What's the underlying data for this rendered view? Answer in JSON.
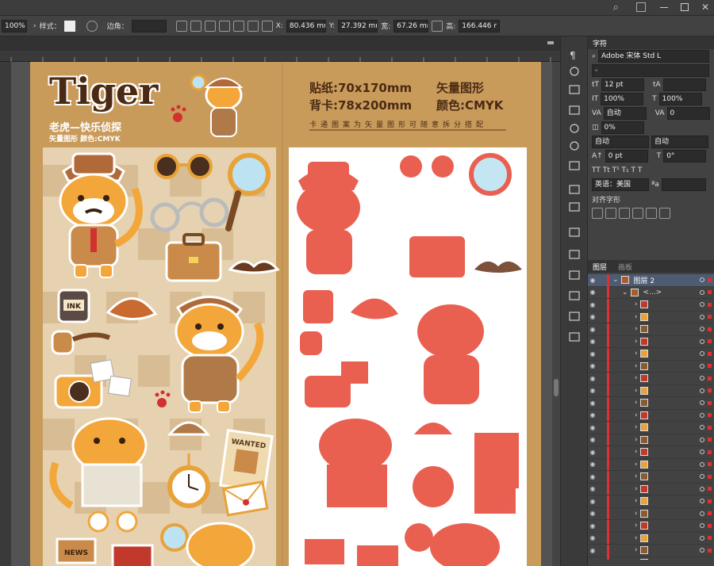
{
  "toolbar": {
    "zoom": "100%",
    "style_label": "样式：",
    "corner_label": "边角：",
    "x_label": "X:",
    "x_value": "80.436 mm",
    "y_label": "Y:",
    "y_value": "27.392 mm",
    "w_label": "宽:",
    "w_value": "67.26 mm",
    "h_label": "高:",
    "h_value": "166.446 r"
  },
  "art": {
    "logo": "Tiger",
    "subtitle": "老虎—快乐侦探",
    "subinfo": "矢量图形  颜色:CMYK",
    "spec1": "贴纸:70x170mm",
    "spec1b": "矢量图形",
    "spec2": "背卡:78x200mm",
    "spec2b": "颜色:CMYK",
    "note": "卡通图案为矢量图形可随意拆分搭配",
    "ink": "INK",
    "wanted": "WANTED",
    "news": "NEWS"
  },
  "char_panel": {
    "tab": "字符",
    "font": "Adobe 宋体 Std L",
    "size": "12 pt",
    "leading": "",
    "scale_v": "100%",
    "scale_h": "100%",
    "kern": "自动",
    "track": "0",
    "shift": "0%",
    "auto1": "自动",
    "auto2": "自动",
    "baseline": "0 pt",
    "rot": "0°",
    "lang": "英语：美国",
    "align_label": "对齐字形"
  },
  "layers_panel": {
    "tab_layers": "图层",
    "tab_boards": "画板",
    "layer_name": "图层 2",
    "group_name": "<...>",
    "row_count": 22
  },
  "colors": {
    "bg": "#535353",
    "art": "#c99b5b",
    "white": "#ffffff",
    "sel": "#e64b3a"
  }
}
